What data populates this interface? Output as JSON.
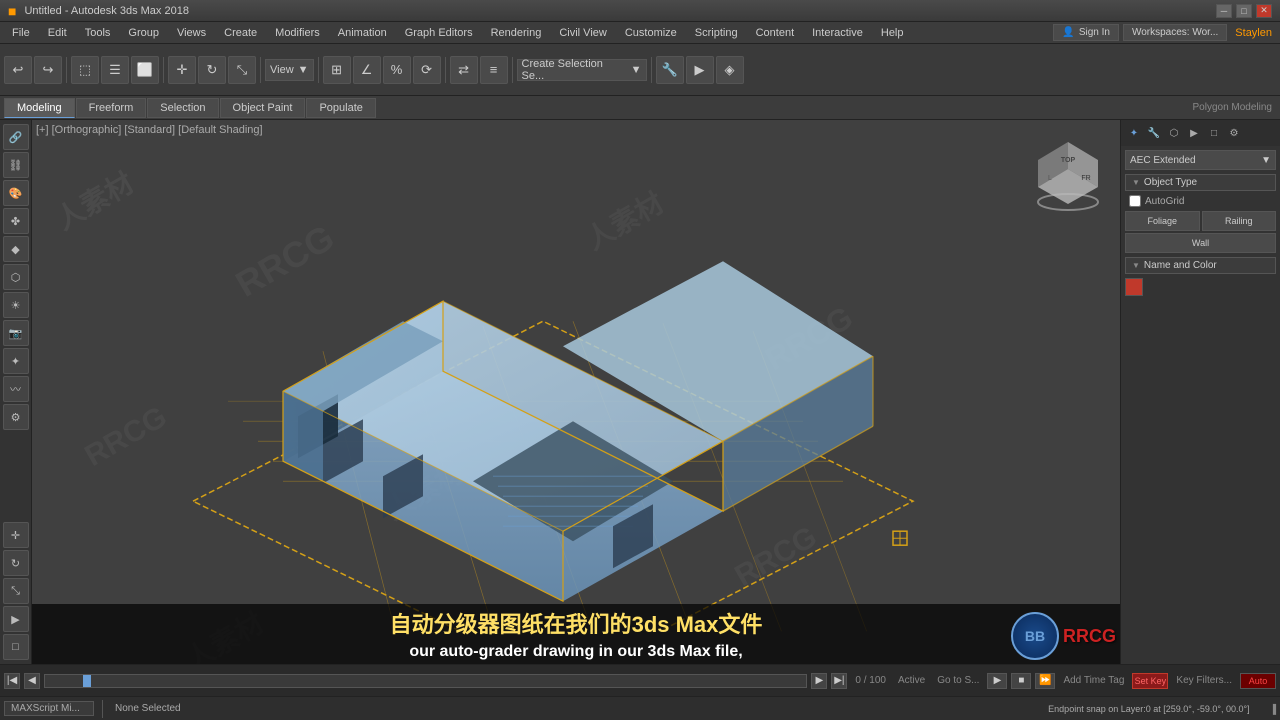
{
  "titleBar": {
    "title": "Untitled - Autodesk 3ds Max 2018",
    "controls": [
      "minimize",
      "restore",
      "close"
    ]
  },
  "menuBar": {
    "items": [
      "File",
      "Edit",
      "Tools",
      "Group",
      "Views",
      "Create",
      "Modifiers",
      "Animation",
      "Graph Editors",
      "Rendering",
      "Civil View",
      "Customize",
      "Scripting",
      "Content",
      "Interactive",
      "Help"
    ]
  },
  "toolbar": {
    "viewLabel": "View",
    "createSelectionLabel": "Create Selection Se...",
    "signIn": "Sign In",
    "workspaces": "Workspaces: Wor...",
    "userName": "Staylen"
  },
  "subToolbar": {
    "tabs": [
      "Modeling",
      "Freeform",
      "Selection",
      "Object Paint",
      "Populate"
    ],
    "activeTab": "Modeling",
    "polygonModeling": "Polygon Modeling"
  },
  "viewport": {
    "header": "[+] [Orthographic] [Standard] [Default Shading]",
    "watermarks": [
      "人素材",
      "RRCG",
      "人素材",
      "RRCG",
      "人素材",
      "RRCG"
    ]
  },
  "rightPanel": {
    "dropdownLabel": "AEC Extended",
    "objectType": {
      "label": "Object Type",
      "autoGrid": "AutoGrid",
      "buttons": [
        "Foliage",
        "Railing",
        "Wall"
      ]
    },
    "nameAndColor": {
      "label": "Name and Color",
      "colorHex": "#c0392b"
    }
  },
  "statusBar": {
    "selection": "None Selected",
    "snap": "Endpoint snap on Layer:0 at [259.0°, -59.0°, 00.0°]",
    "script": "MAXScript Mi...",
    "timePosition": "0 / 100",
    "activeKey": "Active",
    "gotoKey": "Go to S...",
    "addTimeTag": "Add Time Tag",
    "setKey": "Set Key",
    "keyFilters": "Key Filters...",
    "autoKey": "Auto",
    "tickCount": "0/100"
  },
  "subtitles": {
    "chinese": "自动分级器图纸在我们的3ds Max文件",
    "english": "our auto-grader drawing in our 3ds Max file,"
  },
  "navCube": {
    "label": "Navigation Cube"
  }
}
